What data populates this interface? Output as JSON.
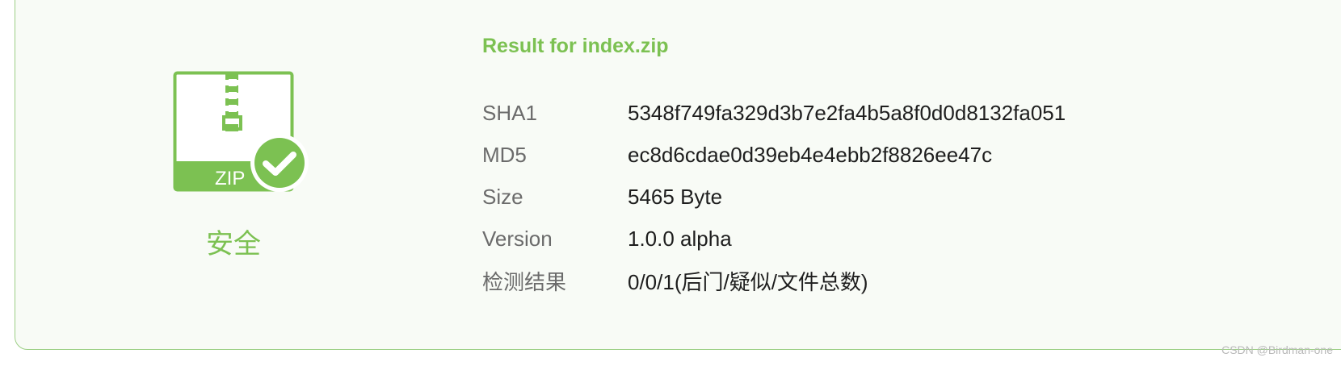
{
  "result": {
    "title": "Result for index.zip",
    "status": "安全",
    "file_type_label": "ZIP"
  },
  "rows": [
    {
      "label": "SHA1",
      "value": "5348f749fa329d3b7e2fa4b5a8f0d0d8132fa051"
    },
    {
      "label": "MD5",
      "value": "ec8d6cdae0d39eb4e4ebb2f8826ee47c"
    },
    {
      "label": "Size",
      "value": "5465 Byte"
    },
    {
      "label": "Version",
      "value": "1.0.0 alpha"
    },
    {
      "label": "检测结果",
      "value": "0/0/1(后门/疑似/文件总数)"
    }
  ],
  "watermark": "CSDN @Birdman-one",
  "colors": {
    "accent": "#7cc152",
    "border": "#9ccf85",
    "card_bg": "#f8fbf6"
  },
  "icons": {
    "file": "zip-file-icon",
    "check": "check-circle-icon"
  }
}
